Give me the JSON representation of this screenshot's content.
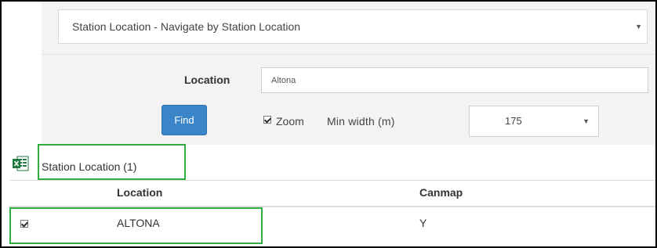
{
  "navigation": {
    "selected": "Station Location - Navigate by Station Location",
    "caret": "▼"
  },
  "search": {
    "location_label": "Location",
    "location_value": "Altona",
    "find_label": "Find",
    "zoom_checked": true,
    "zoom_label": "Zoom",
    "min_width_label": "Min width  (m)",
    "min_width_value": "175",
    "caret": "▼"
  },
  "results": {
    "title": "Station Location (1)",
    "columns": [
      "Location",
      "Canmap"
    ],
    "rows": [
      {
        "checked": true,
        "location": "ALTONA",
        "canmap": "Y"
      }
    ]
  },
  "colors": {
    "find_button": "#3a84c8",
    "highlight_box": "#2fae3f",
    "excel_green": "#1f7a3f"
  }
}
